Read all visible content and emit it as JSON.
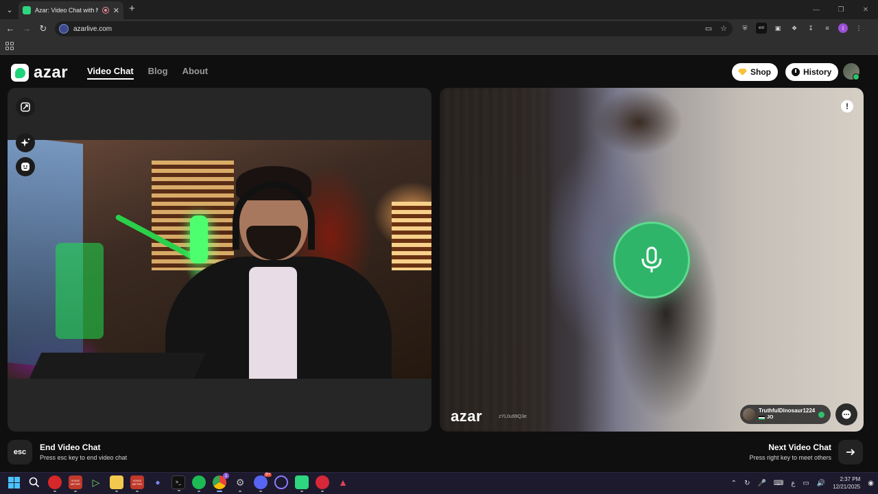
{
  "browser": {
    "tab_title": "Azar: Video Chat with New",
    "url": "azarlive.com",
    "profile_initial": "I",
    "ext_badge": "ext"
  },
  "site": {
    "logo_text": "azar",
    "nav": [
      {
        "label": "Video Chat",
        "active": true
      },
      {
        "label": "Blog",
        "active": false
      },
      {
        "label": "About",
        "active": false
      }
    ],
    "shop_label": "Shop",
    "history_label": "History"
  },
  "remote_video": {
    "watermark": "azar",
    "watermark_id": "zYL0u99Q3e",
    "peer_name": "TruthfulDinosaur1224",
    "peer_country": "JO"
  },
  "controls": {
    "end_key": "esc",
    "end_title": "End Video Chat",
    "end_hint": "Press esc key to end video chat",
    "next_title": "Next Video Chat",
    "next_hint": "Press right key to meet others"
  },
  "taskbar": {
    "time": "2:37 PM",
    "date": "12/21/2025",
    "lang": "ع",
    "discord_badge": "9+",
    "chrome_badge": "1",
    "icon_labels": {
      "cap1": "VOICE METER",
      "cap2": "VOICE METER",
      "terminal": ">_"
    }
  },
  "colors": {
    "brand_green": "#2ed67f",
    "mic_green": "#2fb56a",
    "shop_gem": "#f6c23e"
  }
}
